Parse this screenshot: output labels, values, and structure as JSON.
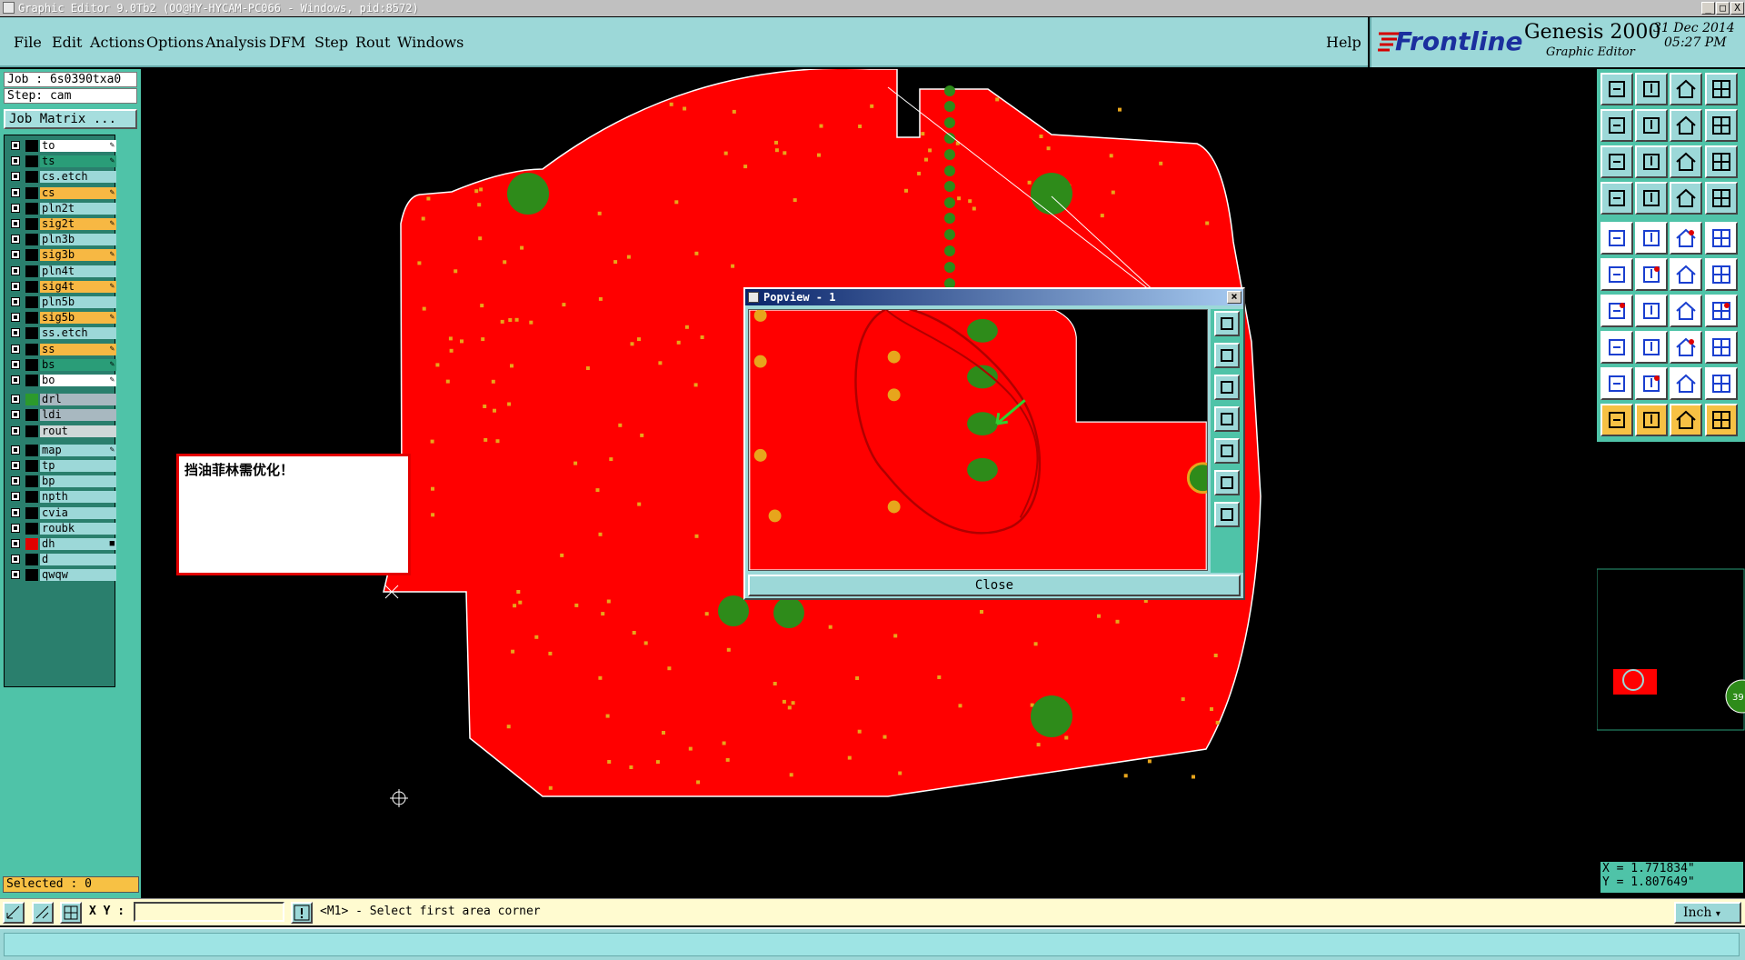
{
  "window": {
    "title": "Graphic Editor 9.0Tb2 (OO@HY-HYCAM-PC066 - Windows, pid:8572)",
    "controls": [
      "_",
      "□",
      "X"
    ]
  },
  "menu": {
    "items": [
      "File",
      "Edit",
      "Actions",
      "Options",
      "Analysis",
      "DFM",
      "Step",
      "Rout",
      "Windows"
    ],
    "help": "Help"
  },
  "brand": {
    "logo": "Frontline",
    "product": "Genesis 2000",
    "subtitle": "Graphic Editor",
    "date": "31 Dec 2014",
    "time": "05:27 PM"
  },
  "job": {
    "job_line": "Job : 6s0390txa0",
    "step_line": "Step: cam",
    "job_matrix": "Job Matrix ..."
  },
  "layers": [
    {
      "name": "to",
      "color": "#ffffff",
      "swatch": "#000000",
      "mark": "pencil"
    },
    {
      "name": "ts",
      "color": "#2a9d78",
      "swatch": "#000000",
      "mark": "pencil"
    },
    {
      "name": "cs.etch",
      "color": "#9cd8d8",
      "swatch": "#000000",
      "mark": ""
    },
    {
      "name": "cs",
      "color": "#f7b843",
      "swatch": "#000000",
      "mark": "pencil"
    },
    {
      "name": "pln2t",
      "color": "#9cd8d8",
      "swatch": "#000000",
      "mark": ""
    },
    {
      "name": "sig2t",
      "color": "#f7b843",
      "swatch": "#000000",
      "mark": "pencil"
    },
    {
      "name": "pln3b",
      "color": "#9cd8d8",
      "swatch": "#000000",
      "mark": ""
    },
    {
      "name": "sig3b",
      "color": "#f7b843",
      "swatch": "#000000",
      "mark": "pencil"
    },
    {
      "name": "pln4t",
      "color": "#9cd8d8",
      "swatch": "#000000",
      "mark": ""
    },
    {
      "name": "sig4t",
      "color": "#f7b843",
      "swatch": "#000000",
      "mark": "pencil"
    },
    {
      "name": "pln5b",
      "color": "#9cd8d8",
      "swatch": "#000000",
      "mark": ""
    },
    {
      "name": "sig5b",
      "color": "#f7b843",
      "swatch": "#000000",
      "mark": "pencil"
    },
    {
      "name": "ss.etch",
      "color": "#9cd8d8",
      "swatch": "#000000",
      "mark": ""
    },
    {
      "name": "ss",
      "color": "#f7b843",
      "swatch": "#000000",
      "mark": "pencil"
    },
    {
      "name": "bs",
      "color": "#2a9d78",
      "swatch": "#000000",
      "mark": "pencil"
    },
    {
      "name": "bo",
      "color": "#ffffff",
      "swatch": "#000000",
      "mark": "pencil"
    },
    {
      "name": "drl",
      "color": "#a8b8c0",
      "swatch": "#2c9a2c",
      "mark": ""
    },
    {
      "name": "ldi",
      "color": "#a8b8c0",
      "swatch": "#000000",
      "mark": ""
    },
    {
      "name": "rout",
      "color": "#cfd8d8",
      "swatch": "#000000",
      "mark": ""
    },
    {
      "name": "map",
      "color": "#9cd8d8",
      "swatch": "#000000",
      "mark": "pencil"
    },
    {
      "name": "tp",
      "color": "#9cd8d8",
      "swatch": "#000000",
      "mark": ""
    },
    {
      "name": "bp",
      "color": "#9cd8d8",
      "swatch": "#000000",
      "mark": ""
    },
    {
      "name": "npth",
      "color": "#9cd8d8",
      "swatch": "#000000",
      "mark": ""
    },
    {
      "name": "cvia",
      "color": "#9cd8d8",
      "swatch": "#000000",
      "mark": ""
    },
    {
      "name": "roubk",
      "color": "#9cd8d8",
      "swatch": "#000000",
      "mark": ""
    },
    {
      "name": "dh",
      "color": "#9cd8d8",
      "swatch": "#e00000",
      "mark": "square"
    },
    {
      "name": "d",
      "color": "#9cd8d8",
      "swatch": "#000000",
      "mark": ""
    },
    {
      "name": "qwqw",
      "color": "#9cd8d8",
      "swatch": "#000000",
      "mark": ""
    }
  ],
  "selected": "Selected : 0",
  "note": {
    "text": "挡油菲林需优化！"
  },
  "popview": {
    "title": "Popview - 1",
    "close_label": "Close"
  },
  "coords": {
    "x": "X = 1.771834\"",
    "y": "Y = 1.807649\""
  },
  "minimap": {
    "badge": "39"
  },
  "bottom": {
    "xy_label": "X Y :",
    "xy_value": "",
    "prompt": "<M1> - Select first area corner",
    "unit": "Inch"
  },
  "colors": {
    "board": "#ff0000",
    "pad": "#2e8b1a",
    "via": "#e7a51c",
    "panel": "#4fc3a8",
    "menu": "#9cd8d8"
  }
}
